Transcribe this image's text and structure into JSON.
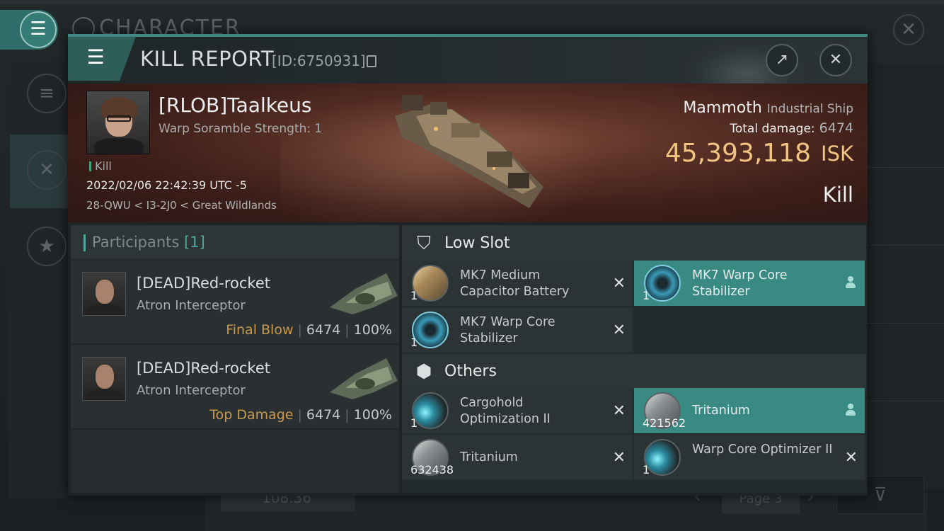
{
  "background": {
    "title": "CHARACTER",
    "bottom_value": "108.36",
    "page_label": "Page 3",
    "close_glyph": "✕",
    "side_icons": [
      "menu-icon",
      "crossed-swords-icon",
      "star-icon"
    ]
  },
  "menu_glyph": "☰",
  "dialog": {
    "title": "KILL REPORT",
    "id": "[ID:6750931]",
    "menu_icon": "☰",
    "share_icon": "↗",
    "close_icon": "✕"
  },
  "victim": {
    "name": "[RLOB]Taalkeus",
    "subtitle": "Warp Soramble Strength: 1",
    "tag": "Kill",
    "date": "2022/02/06 22:42:39 UTC -5",
    "location": "28-QWU < I3-2J0 < Great Wildlands"
  },
  "ship": {
    "name": "Mammoth",
    "class": "Industrial Ship",
    "total_damage_label": "Total damage:",
    "total_damage": "6474",
    "isk_value": "45,393,118",
    "isk_unit": "ISK",
    "result": "Kill"
  },
  "participants": {
    "title": "Participants",
    "count": "[1]",
    "rows": [
      {
        "name": "[DEAD]Red-rocket",
        "ship": "Atron Interceptor",
        "label": "Final Blow",
        "damage": "6474",
        "percent": "100%"
      },
      {
        "name": "[DEAD]Red-rocket",
        "ship": "Atron Interceptor",
        "label": "Top Damage",
        "damage": "6474",
        "percent": "100%"
      }
    ]
  },
  "sections": {
    "low_slot": {
      "title": "Low Slot",
      "icon": "shield-slot-icon"
    },
    "others": {
      "title": "Others",
      "icon": "cube-icon"
    }
  },
  "items": {
    "low": [
      {
        "name": "MK7 Medium Capacitor Battery",
        "qty": "1",
        "icon": "capacitor-battery-icon",
        "state": "destroyed"
      },
      {
        "name": "MK7 Warp Core Stabilizer",
        "qty": "1",
        "icon": "warp-core-stabilizer-icon",
        "state": "dropped"
      },
      {
        "name": "MK7 Warp Core Stabilizer",
        "qty": "1",
        "icon": "warp-core-stabilizer-icon",
        "state": "destroyed"
      }
    ],
    "others": [
      {
        "name": "Cargohold Optimization II",
        "qty": "1",
        "icon": "cargohold-optimization-icon",
        "state": "destroyed"
      },
      {
        "name": "Tritanium",
        "qty": "421562",
        "icon": "tritanium-icon",
        "state": "dropped"
      },
      {
        "name": "Tritanium",
        "qty": "632438",
        "icon": "tritanium-icon",
        "state": "destroyed"
      },
      {
        "name": "Warp Core Optimizer II",
        "qty": "1",
        "icon": "warp-core-optimizer-icon",
        "state": "destroyed"
      }
    ]
  },
  "colors": {
    "accent": "#3f8985",
    "isk": "#f2c482",
    "final_blow": "#c99a4e",
    "dropped_highlight": "#3a8a84"
  }
}
